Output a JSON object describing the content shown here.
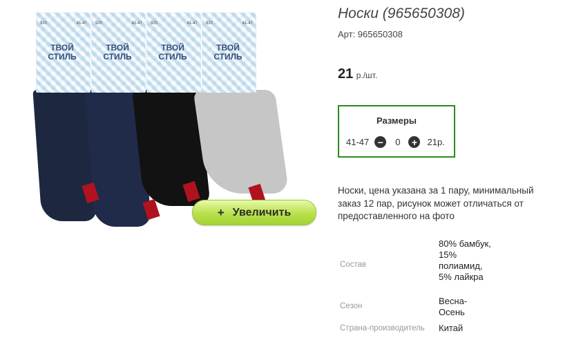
{
  "product": {
    "title": "Носки (965650308)",
    "article": "Арт: 965650308",
    "price_value": "21",
    "price_unit": "р./шт."
  },
  "photo": {
    "card_brand": "ТВОЙ СТИЛЬ",
    "card_sizes": "41-47",
    "card_code": "920",
    "sock_colors": [
      "#1d2840",
      "#1f2b48",
      "#121212",
      "#c6c6c6"
    ]
  },
  "gallery": {
    "zoom_label": "Увеличить",
    "zoom_icon": "plus-icon"
  },
  "sizes": {
    "title": "Размеры",
    "size": "41-47",
    "quantity": "0",
    "price": "21р.",
    "decrement_icon": "minus-circle-icon",
    "increment_icon": "plus-circle-icon"
  },
  "description": "Носки, цена указана за 1 пару, минимальный заказ 12 пар, рисунок может отличаться от предоставленного на фото",
  "properties": [
    {
      "label": "Состав",
      "value": "80% бамбук, 15% полиамид, 5% лайкра"
    },
    {
      "label": "Сезон",
      "value": "Весна-Осень"
    },
    {
      "label": "Страна-производитель",
      "value": "Китай"
    }
  ],
  "colors": {
    "accent_border": "#2a8a1e",
    "zoom_button": "#b8e04c"
  }
}
